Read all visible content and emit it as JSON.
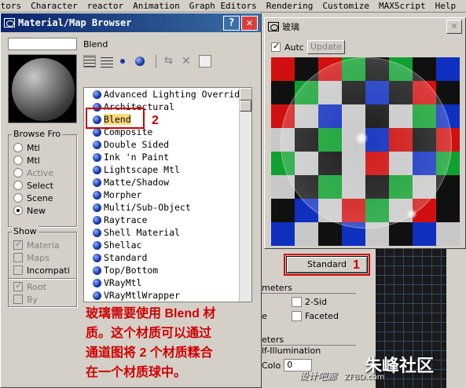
{
  "menubar": [
    "itors",
    "Character",
    "reactor",
    "Animation",
    "Graph Editors",
    "Rendering",
    "Customize",
    "MAXScript",
    "Help"
  ],
  "browser": {
    "title": "Material/Map Browser",
    "help_btn": "?",
    "close_btn": "✕",
    "current_type": "Blend",
    "browse_from": {
      "label": "Browse From",
      "label_display": "Browse Fro",
      "options": [
        {
          "label": "Mtl",
          "selected": false,
          "disabled": false
        },
        {
          "label": "Mtl",
          "selected": false,
          "disabled": false
        },
        {
          "label": "Active",
          "selected": false,
          "disabled": true
        },
        {
          "label": "Select",
          "selected": false,
          "disabled": false
        },
        {
          "label": "Scene",
          "selected": false,
          "disabled": false
        },
        {
          "label": "New",
          "selected": true,
          "disabled": false
        }
      ]
    },
    "show": {
      "label": "Show",
      "options": [
        {
          "label": "Materia",
          "checked": true
        },
        {
          "label": "Maps",
          "checked": false
        },
        {
          "label": "Incompati",
          "checked": false
        }
      ]
    },
    "extra_options": [
      {
        "label": "Root",
        "checked": true
      },
      {
        "label": "By",
        "checked": false
      }
    ],
    "materials": [
      "Advanced Lighting Overrid",
      "Architectural",
      "Blend",
      "Composite",
      "Double Sided",
      "Ink 'n Paint",
      "Lightscape Mtl",
      "Matte/Shadow",
      "Morpher",
      "Multi/Sub-Object",
      "Raytrace",
      "Shell Material",
      "Shellac",
      "Standard",
      "Top/Bottom",
      "VRayMtl",
      "VRayMtlWrapper"
    ],
    "selected_index": 2
  },
  "annotation": {
    "marker_2": "2",
    "marker_1": "1",
    "note_line1": "玻璃需要使用 Blend 材",
    "note_line2": "质。这个材质可以通过",
    "note_line3": "通道图将 2 个材质糅合",
    "note_line4": "在一个材质球中。"
  },
  "glass_window": {
    "title": "玻璃",
    "close_btn": "✕",
    "auto_label": "Autc",
    "update_label": "Update"
  },
  "material_editor": {
    "standard_btn": "Standard",
    "params_header1": "meters",
    "two_sided": "2-Sid",
    "faceted": "Faceted",
    "e_label": "e",
    "params_header2": "eters",
    "self_illum": "lf-Illumination",
    "colo_label": "Colo",
    "colo_value": "0"
  },
  "watermark": {
    "main": "朱峰社区",
    "sub": "设计吧廊",
    "url": "ZFBD.com"
  },
  "colors": {
    "checker": [
      "#d01010",
      "#10a030",
      "#1030c0",
      "#c8c8c8",
      "#101010"
    ],
    "annotation_red": "#d00000"
  }
}
